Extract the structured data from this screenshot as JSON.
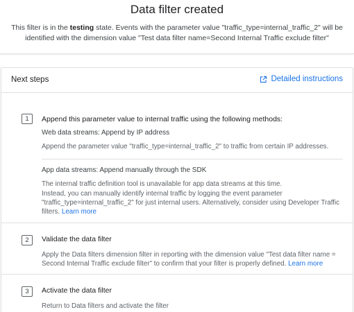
{
  "header": {
    "title": "Data filter created",
    "desc_prefix": "This filter is in the ",
    "desc_state": "testing",
    "desc_suffix": " state. Events with the parameter value \"traffic_type=internal_traffic_2\" will be identified with the dimension value \"Test data filter name=Second Internal Traffic exclude filter\""
  },
  "next_steps": {
    "title": "Next steps",
    "detailed_instructions": "Detailed instructions",
    "step1": {
      "number": "1",
      "title": "Append this parameter value to internal traffic using the following methods:",
      "web": {
        "title": "Web data streams: Append by IP address",
        "body": "Append the parameter value \"traffic_type=internal_traffic_2\" to traffic from certain IP addresses."
      },
      "app": {
        "title": "App data streams: Append manually through the SDK",
        "body1": "The internal traffic definition tool is unavailable for app data streams at this time.",
        "body2": "Instead, you can manually identify internal traffic by logging the event parameter \"traffic_type=internal_traffic_2\" for just internal users. Alternatively, consider using Developer Traffic filters.",
        "learn_more": "Learn more"
      }
    },
    "step2": {
      "number": "2",
      "title": "Validate the data filter",
      "body": "Apply the Data filters dimension filter in reporting with the dimension value \"Test data filter name = Second Internal Traffic exclude filter\" to confirm that your filter is properly defined.",
      "learn_more": "Learn more"
    },
    "step3": {
      "number": "3",
      "title": "Activate the data filter",
      "body": "Return to Data filters and activate the filter"
    }
  },
  "colors": {
    "link": "#1a73e8",
    "text": "#202124",
    "muted": "#5f6368",
    "divider": "#e0e0e0"
  }
}
